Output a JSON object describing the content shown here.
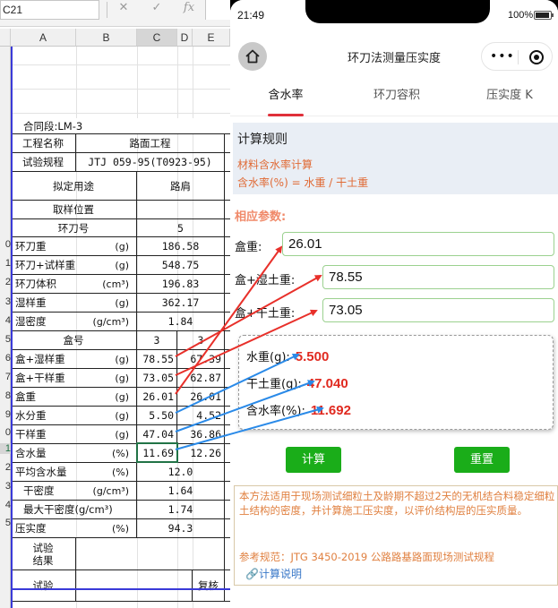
{
  "excel": {
    "name_box": "C21",
    "fx_cancel_icon": "✕",
    "fx_enter_icon": "✓",
    "fx_label": "fx",
    "columns": [
      "A",
      "B",
      "C",
      "D",
      "E"
    ],
    "row_numbers": [
      "0",
      "1",
      "2",
      "3",
      "4",
      "5",
      "6",
      "7",
      "8",
      "9",
      "0",
      "1",
      "2",
      "3",
      "4",
      "5"
    ],
    "contract": "合同段:LM-3",
    "project_label": "工程名称",
    "project_value": "路面工程",
    "spec_label": "试验规程",
    "spec_value": "JTJ 059-95(T0923-95)",
    "use_label": "拟定用途",
    "use_value": "路肩",
    "sampling_label": "取样位置",
    "ring_no_label": "环刀号",
    "ring_no_value": "5",
    "ring_weight_label": "环刀重",
    "ring_weight_unit": "(g)",
    "ring_weight_value": "186.58",
    "ring_plus_sample_label": "环刀+试样重",
    "ring_plus_sample_unit": "(g)",
    "ring_plus_sample_value": "548.75",
    "ring_volume_label": "环刀体积",
    "ring_volume_unit": "(cm³)",
    "ring_volume_value": "196.83",
    "wet_weight_label": "湿样重",
    "wet_weight_unit": "(g)",
    "wet_weight_value": "362.17",
    "wet_density_label": "湿密度",
    "wet_density_unit": "(g/cm³)",
    "wet_density_value": "1.84",
    "box_no_label": "盒号",
    "box_no_c": "3",
    "box_no_e": "3",
    "box_wet_label": "盒+湿样重",
    "box_wet_unit": "(g)",
    "box_wet_c": "78.55",
    "box_wet_e": "67.39",
    "box_dry_label": "盒+干样重",
    "box_dry_unit": "(g)",
    "box_dry_c": "73.05",
    "box_dry_e": "62.87",
    "box_label": "盒重",
    "box_unit": "(g)",
    "box_c": "26.01",
    "box_e": "26.01",
    "water_label": "水分重",
    "water_unit": "(g)",
    "water_c": "5.50",
    "water_e": "4.52",
    "dry_label": "干样重",
    "dry_unit": "(g)",
    "dry_c": "47.04",
    "dry_e": "36.86",
    "moisture_label": "含水量",
    "moisture_unit": "(%)",
    "moisture_c": "11.69",
    "moisture_e": "12.26",
    "avg_moisture_label": "平均含水量",
    "avg_moisture_unit": "(%)",
    "avg_moisture_value": "12.0",
    "dry_density_label": "干密度",
    "dry_density_unit": "(g/cm³)",
    "dry_density_value": "1.64",
    "max_dry_density_label": "最大干密度(g/cm³)",
    "max_dry_density_value": "1.74",
    "compaction_label": "压实度",
    "compaction_unit": "(%)",
    "compaction_value": "94.3",
    "result_label_1": "试验",
    "result_label_2": "结果",
    "tester_label": "试验",
    "reviewer_label": "复核"
  },
  "phone": {
    "status_time": "21:49",
    "battery_text": "100%",
    "battery_level": 0.95,
    "nav_title": "环刀法测量压实度",
    "home_icon": "home-icon",
    "menu_dots": "•••",
    "tabs": [
      "含水率",
      "环刀容积",
      "压实度 K"
    ],
    "active_tab": 0,
    "rules_title": "计算规则",
    "rules_line1": "材料含水率计算",
    "rules_line2": "含水率(%) = 水重 / 干土重",
    "params_title": "相应参数:",
    "box_weight_label": "盒重:",
    "box_weight_value": "26.01",
    "box_wet_label": "盒+湿土重:",
    "box_wet_value": "78.55",
    "box_dry_label": "盒+干土重:",
    "box_dry_value": "73.05",
    "water_label": "水重(g):",
    "water_value": "5.500",
    "dry_label": "干土重(g):",
    "dry_value": "47.040",
    "moisture_label": "含水率(%):",
    "moisture_value": "11.692",
    "calc_button": "计算",
    "reset_button": "重置",
    "note_text": "本方法适用于现场测试细粒土及龄期不超过2天的无机结合料稳定细粒土结构的密度，并计算施工压实度，以评价结构层的压实质量。",
    "note_ref": "参考规范：JTG 3450-2019 公路路基路面现场测试规程",
    "note_link": "🔗计算说明",
    "colors": {
      "accent_red": "#e0303a",
      "green_button": "#1aad19",
      "orange_text": "#e06a35",
      "result_red": "#e02a20",
      "arrow_red": "#e8302a",
      "arrow_blue": "#2a8ae8"
    }
  }
}
